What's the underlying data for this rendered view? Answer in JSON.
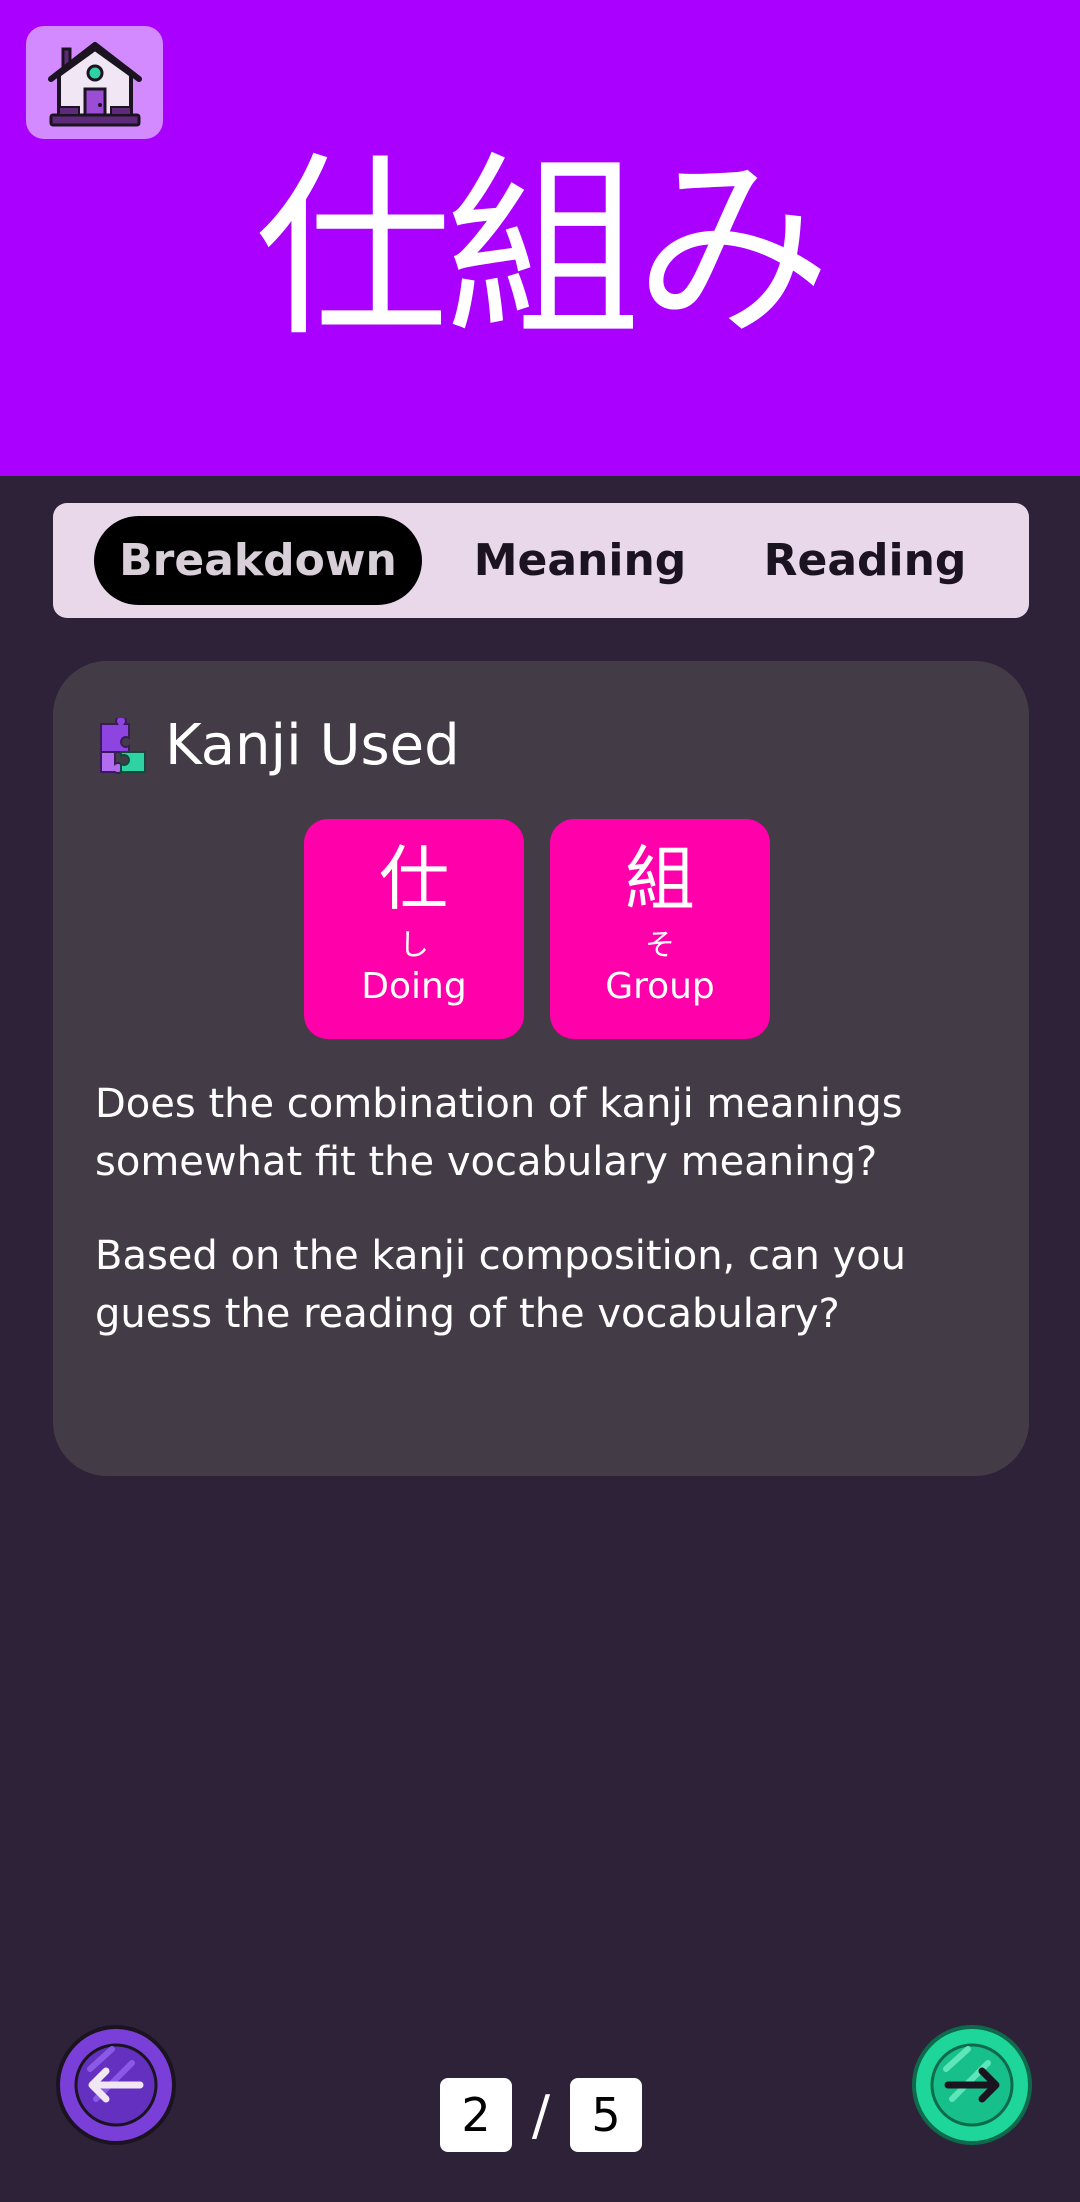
{
  "header": {
    "vocabulary": "仕組み",
    "home_icon": "home-icon",
    "background_color": "#aa00ff"
  },
  "tabs": [
    {
      "label": "Breakdown",
      "active": true
    },
    {
      "label": "Meaning",
      "active": false
    },
    {
      "label": "Reading",
      "active": false
    }
  ],
  "card": {
    "icon": "puzzle-icon",
    "title": "Kanji Used",
    "kanji": [
      {
        "character": "仕",
        "reading": "し",
        "meaning": "Doing"
      },
      {
        "character": "組",
        "reading": "そ",
        "meaning": "Group"
      }
    ],
    "paragraphs": [
      "Does the combination of kanji meanings somewhat fit the vocabulary meaning?",
      "Based on the kanji composition, can you guess the reading of the vocabulary?"
    ]
  },
  "pagination": {
    "current": "2",
    "separator": "/",
    "total": "5"
  },
  "navigation": {
    "prev_icon": "arrow-left-icon",
    "next_icon": "arrow-right-icon"
  },
  "colors": {
    "accent": "#aa00ff",
    "kanji_tile": "#ff00aa",
    "background": "#2e2239",
    "card": "#433c47",
    "next_button": "#1fd69a",
    "prev_button": "#7a3fd8"
  }
}
